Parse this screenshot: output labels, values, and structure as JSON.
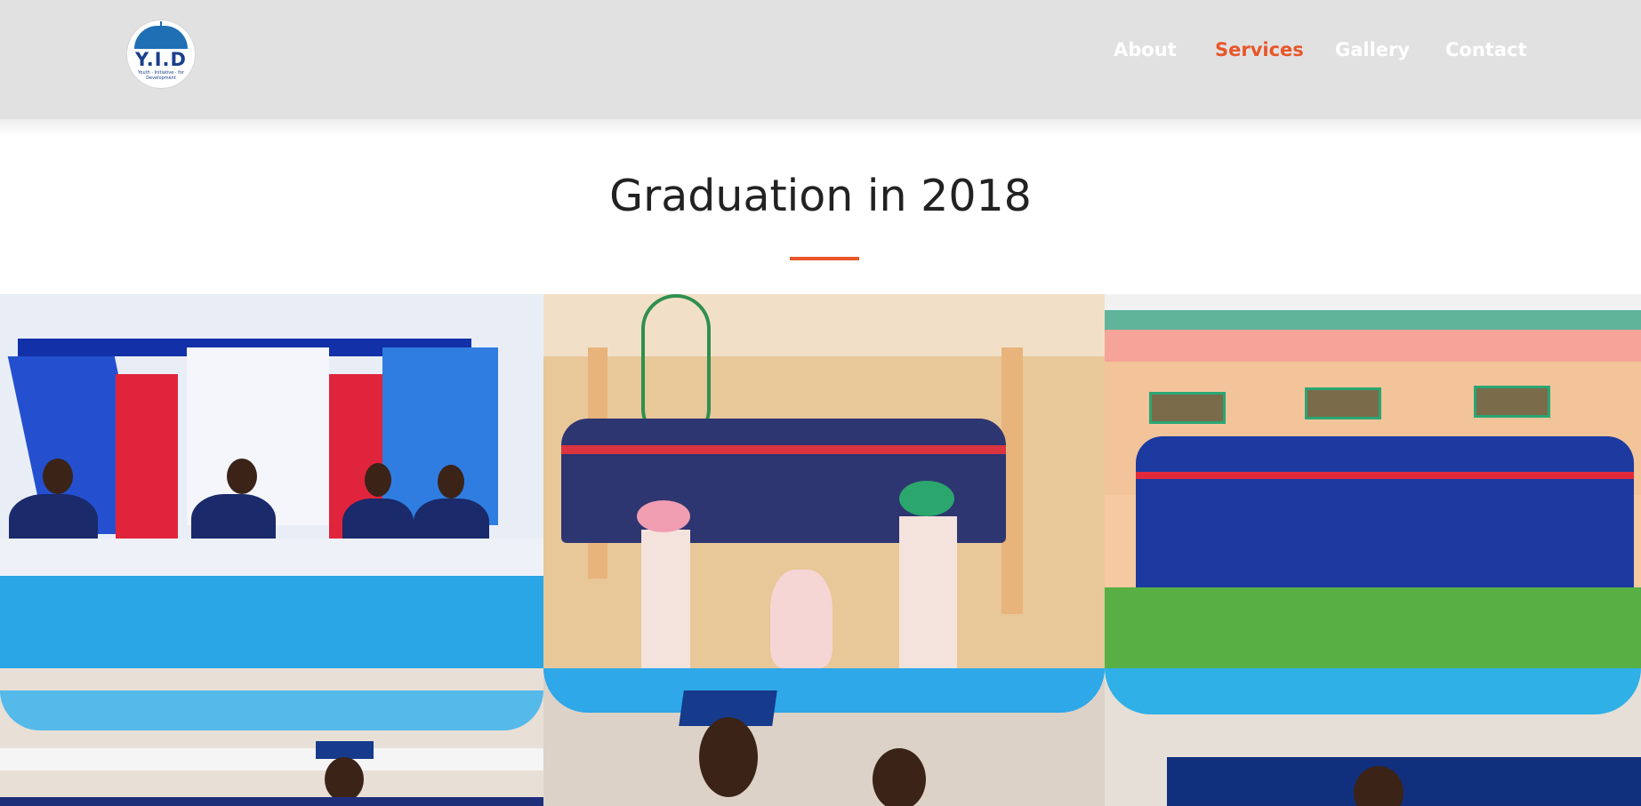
{
  "header": {
    "logo_text": "Y.I.D",
    "logo_subtext": "Youth · Initiative · for Development",
    "nav": [
      {
        "label": "About",
        "active": false
      },
      {
        "label": "Services",
        "active": true
      },
      {
        "label": "Gallery",
        "active": false
      },
      {
        "label": "Contact",
        "active": false
      }
    ]
  },
  "main": {
    "title": "Graduation in 2018"
  },
  "gallery": {
    "photos": [
      {
        "subject": "officials-at-head-table"
      },
      {
        "subject": "graduates-seated-in-hall"
      },
      {
        "subject": "group-of-graduates-outdoors"
      },
      {
        "subject": "graduate-at-podium"
      },
      {
        "subject": "graduate-smiling"
      },
      {
        "subject": "graduate-under-drapes"
      }
    ]
  },
  "colors": {
    "header_bg": "#e1e1e1",
    "accent": "#e8562a",
    "title": "#222222"
  }
}
